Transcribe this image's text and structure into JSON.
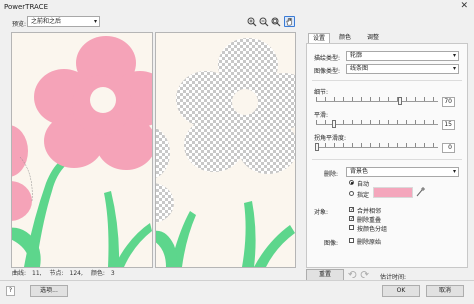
{
  "window": {
    "title": "PowerTRACE",
    "close_glyph": "✕"
  },
  "preview": {
    "label": "预览:",
    "mode": "之前和之后"
  },
  "icons": {
    "zoom_in": "zoom-in-icon",
    "zoom_out": "zoom-out-icon",
    "zoom_fit": "zoom-fit-icon",
    "hand": "hand-icon",
    "undo": "undo-icon",
    "redo": "redo-icon",
    "eyedropper": "eyedropper-icon"
  },
  "colors": {
    "accent": "#3a7bd5",
    "flower_pink": "#f5a3b8",
    "stem_green": "#5dd68c",
    "background_cream": "#fbf6ee",
    "swatch": "#f4a6bc"
  },
  "status": {
    "curves_label": "曲线:",
    "curves": "11,",
    "nodes_label": "节点:",
    "nodes": "124,",
    "colors_label": "颜色:",
    "colors": "3"
  },
  "tabs": [
    "设置",
    "颜色",
    "调整"
  ],
  "settings": {
    "trace_type_label": "描绘类型:",
    "trace_type": "轮廓",
    "image_type_label": "图像类型:",
    "image_type": "线条图",
    "detail_label": "细节:",
    "detail_value": "70",
    "detail_level": 0.7,
    "smoothing_label": "平滑:",
    "smoothing_value": "15",
    "smoothing_level": 0.15,
    "corner_label": "拐角平滑度:",
    "corner_value": "0",
    "corner_level": 0,
    "remove_label": "删除:",
    "remove_value": "背景色",
    "auto_label": "自动",
    "specify_label": "指定",
    "objects_label": "对象:",
    "merge_adjacent": "合并相邻",
    "merge_adjacent_checked": true,
    "remove_overlap": "删除重叠",
    "remove_overlap_checked": true,
    "group_by_color": "按颜色分组",
    "group_by_color_checked": false,
    "image_label": "图像:",
    "remove_original": "删除原始",
    "remove_original_checked": false
  },
  "buttons": {
    "reset": "重置",
    "estimate_label": "估计时间:",
    "options": "选项...",
    "help": "?",
    "ok": "OK",
    "cancel": "取消"
  }
}
